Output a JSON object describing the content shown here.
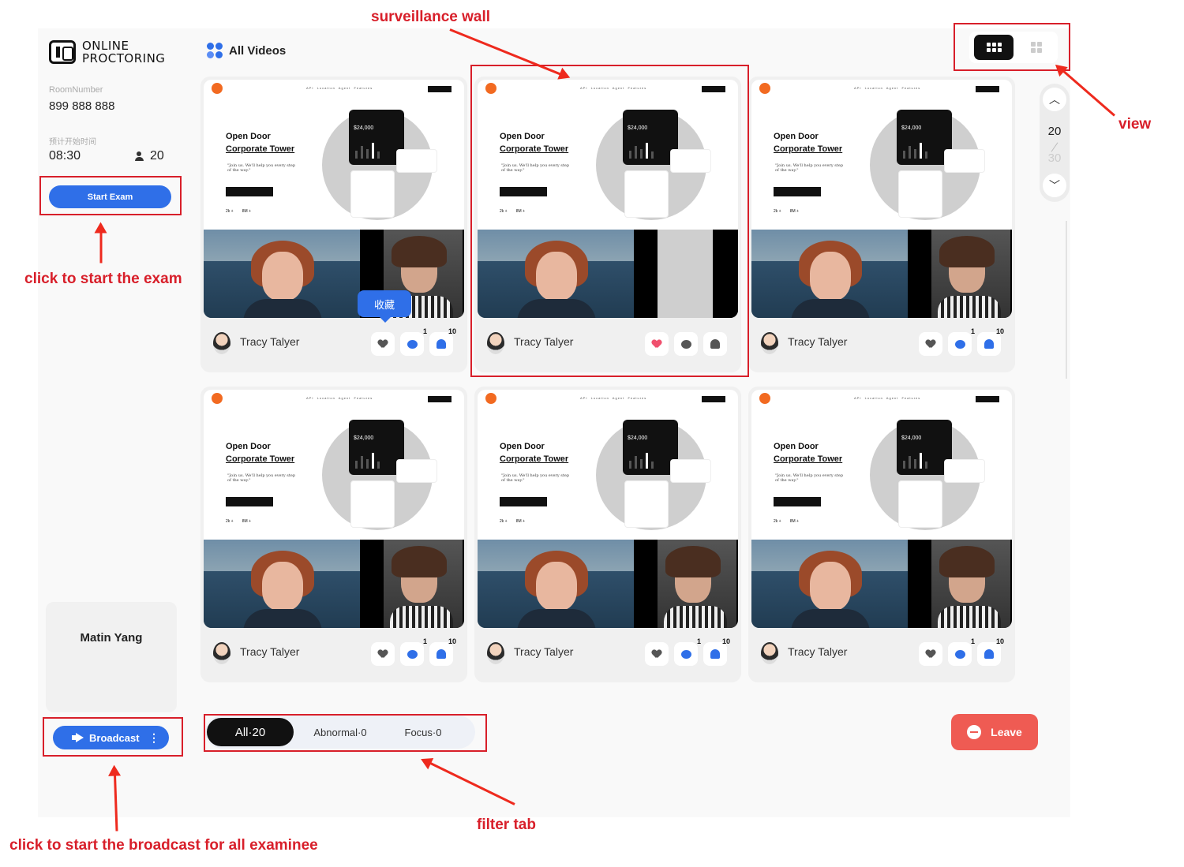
{
  "sidebar": {
    "logo_line1": "ONLINE",
    "logo_line2": "PROCTORING",
    "room_label": "RoomNumber",
    "room_number": "899 888 888",
    "start_label": "预计开始时间",
    "start_time": "08:30",
    "examinee_count": "20",
    "start_exam_label": "Start Exam",
    "user_name": "Matin Yang",
    "broadcast_label": "Broadcast"
  },
  "header": {
    "title": "All Videos"
  },
  "pager": {
    "current": "20",
    "total": "30"
  },
  "tiles": [
    {
      "name": "Tracy Talyer",
      "favorite": false,
      "chat_badge": "1",
      "alert_badge": "10"
    },
    {
      "name": "Tracy Talyer",
      "favorite": true,
      "chat_badge": "",
      "alert_badge": ""
    },
    {
      "name": "Tracy Talyer",
      "favorite": false,
      "chat_badge": "1",
      "alert_badge": "10"
    },
    {
      "name": "Tracy Talyer",
      "favorite": false,
      "chat_badge": "1",
      "alert_badge": "10"
    },
    {
      "name": "Tracy Talyer",
      "favorite": false,
      "chat_badge": "1",
      "alert_badge": "10"
    },
    {
      "name": "Tracy Talyer",
      "favorite": false,
      "chat_badge": "1",
      "alert_badge": "10"
    }
  ],
  "screen_mock": {
    "title_line1": "Open Door",
    "title_line2": "Corporate Tower",
    "quote": "\"Join us. We'll help you every step of the way.\"",
    "amount": "$24,000",
    "stat1": "2k +",
    "stat2": "8M +"
  },
  "tooltip": "收藏",
  "filter_tabs": {
    "all": "All·20",
    "abnormal": "Abnormal·0",
    "focus": "Focus·0"
  },
  "leave_label": "Leave",
  "annotations": {
    "wall": "surveillance wall",
    "view": "view",
    "start": "click to start the exam",
    "broadcast": "click to start the broadcast for all examinee",
    "filter": "filter tab"
  },
  "colors": {
    "accent": "#2f6fe8",
    "leave": "#ef5b53",
    "annotation": "#d81f2a"
  }
}
